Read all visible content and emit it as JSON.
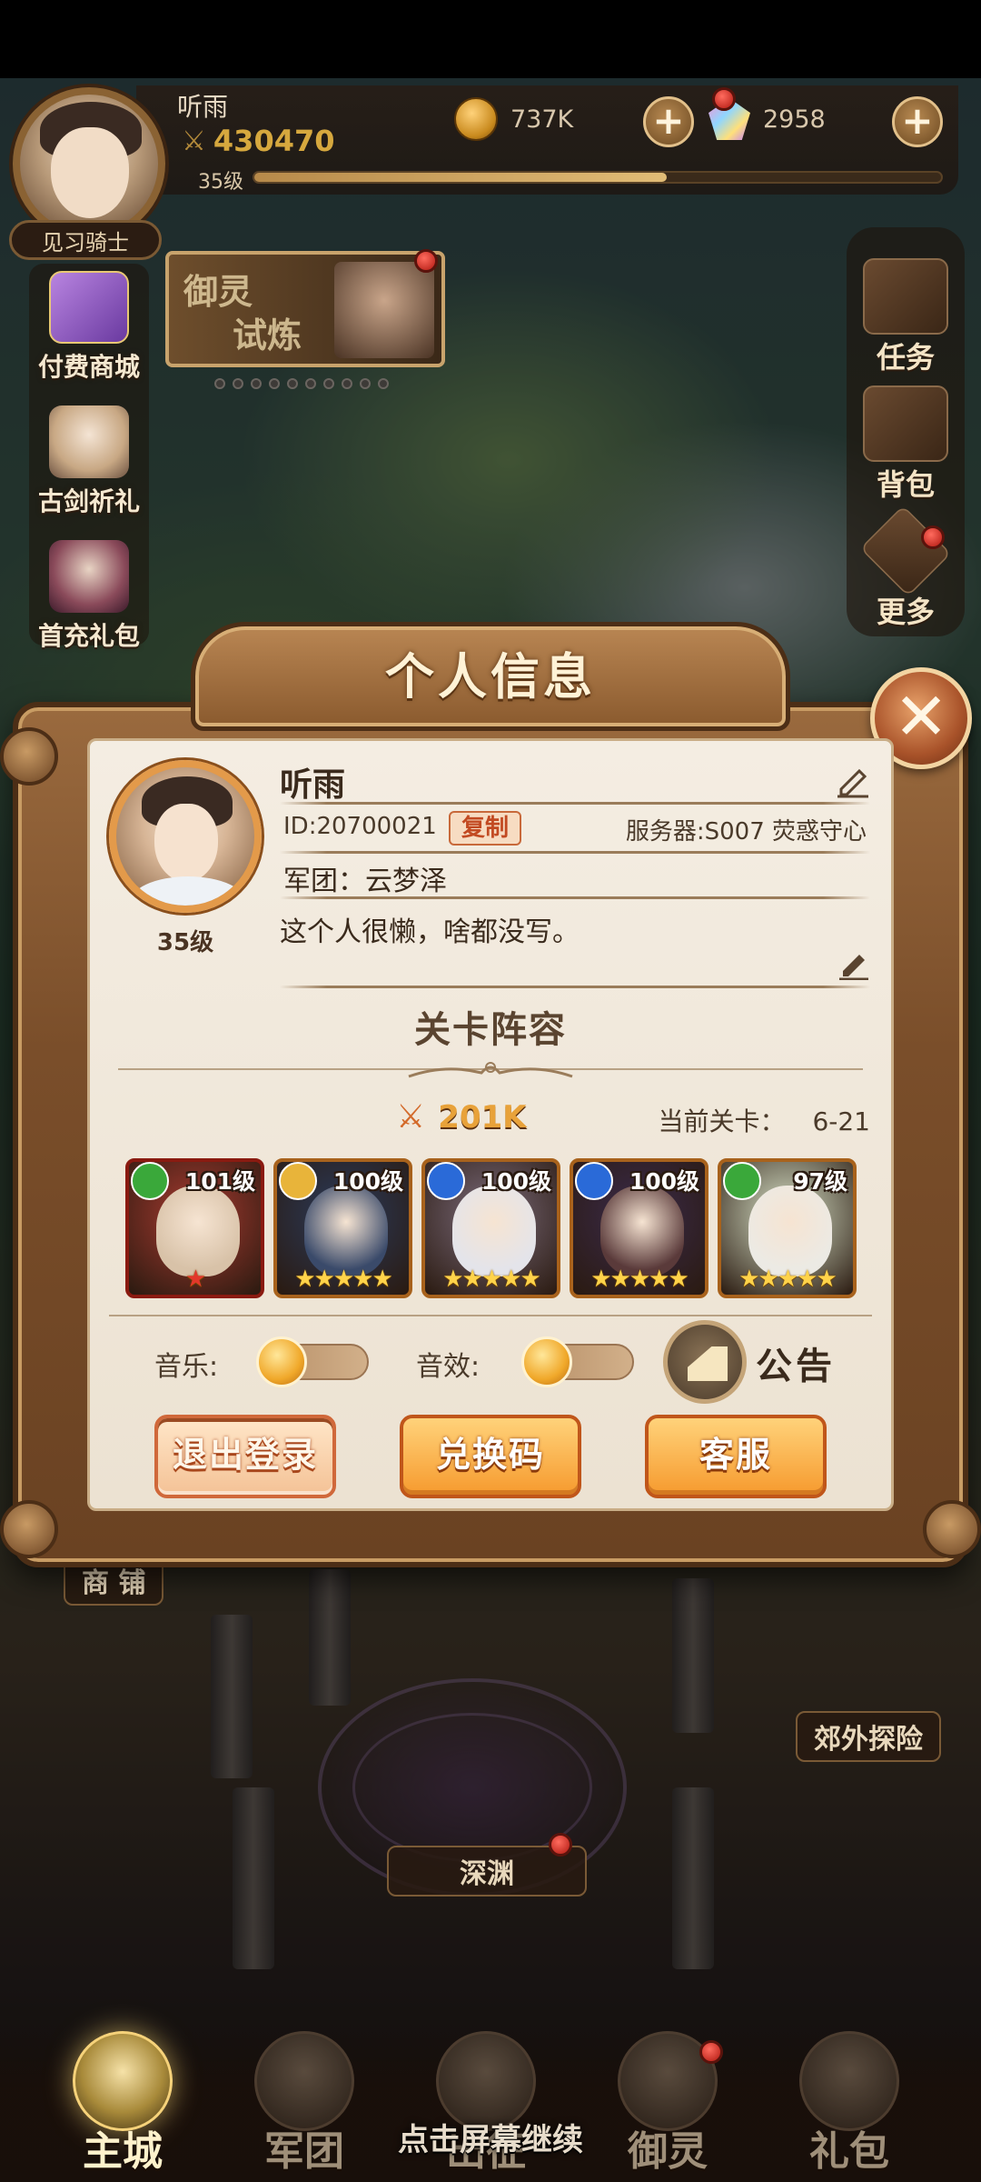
{
  "hud": {
    "player_name": "听雨",
    "power": "430470",
    "level": "35级",
    "xp_fraction": 0.6,
    "rank": "见习骑士",
    "gold": "737K",
    "gems": "2958"
  },
  "side_left": [
    {
      "label": "付费商城",
      "icon": "gift-box-icon"
    },
    {
      "label": "古剑祈礼",
      "icon": "hero-portrait-icon"
    },
    {
      "label": "首充礼包",
      "icon": "hero-portrait-icon"
    }
  ],
  "banner": {
    "line1": "御灵",
    "line2": "试炼"
  },
  "side_right": [
    {
      "label": "任务",
      "icon": "quest-scroll-icon"
    },
    {
      "label": "背包",
      "icon": "backpack-icon"
    },
    {
      "label": "更多",
      "icon": "more-grid-icon"
    }
  ],
  "map_tags": {
    "shop": "商 铺",
    "explore": "郊外探险",
    "abyss": "深渊"
  },
  "bottom_nav": [
    {
      "label": "主城",
      "active": true
    },
    {
      "label": "军团",
      "active": false
    },
    {
      "label": "出征",
      "active": false
    },
    {
      "label": "御灵",
      "active": false
    },
    {
      "label": "礼包",
      "active": false
    }
  ],
  "continue_hint": "点击屏幕继续",
  "modal": {
    "title": "个人信息",
    "name": "听雨",
    "id_text": "ID:20700021",
    "copy_label": "复制",
    "server": "服务器:S007 荧惑守心",
    "guild": "军团：云梦泽",
    "signature": "这个人很懒，啥都没写。",
    "avatar_level": "35级",
    "lineup_title": "关卡阵容",
    "lineup_power": "201K",
    "stage_label": "当前关卡：",
    "stage_value": "6-21",
    "heroes": [
      {
        "level": "101级",
        "stars": "★",
        "element": "wind",
        "color": "#d9433a"
      },
      {
        "level": "100级",
        "stars": "★★★★★",
        "element": "gold",
        "color": "#e8a23a"
      },
      {
        "level": "100级",
        "stars": "★★★★★",
        "element": "water",
        "color": "#e8a23a"
      },
      {
        "level": "100级",
        "stars": "★★★★★",
        "element": "water",
        "color": "#e8a23a"
      },
      {
        "level": "97级",
        "stars": "★★★★★",
        "element": "wind",
        "color": "#e8a23a"
      }
    ],
    "music_label": "音乐:",
    "music_on": false,
    "sfx_label": "音效:",
    "sfx_on": false,
    "notice_label": "公告",
    "buttons": {
      "logout": "退出登录",
      "redeem": "兑换码",
      "support": "客服"
    }
  }
}
